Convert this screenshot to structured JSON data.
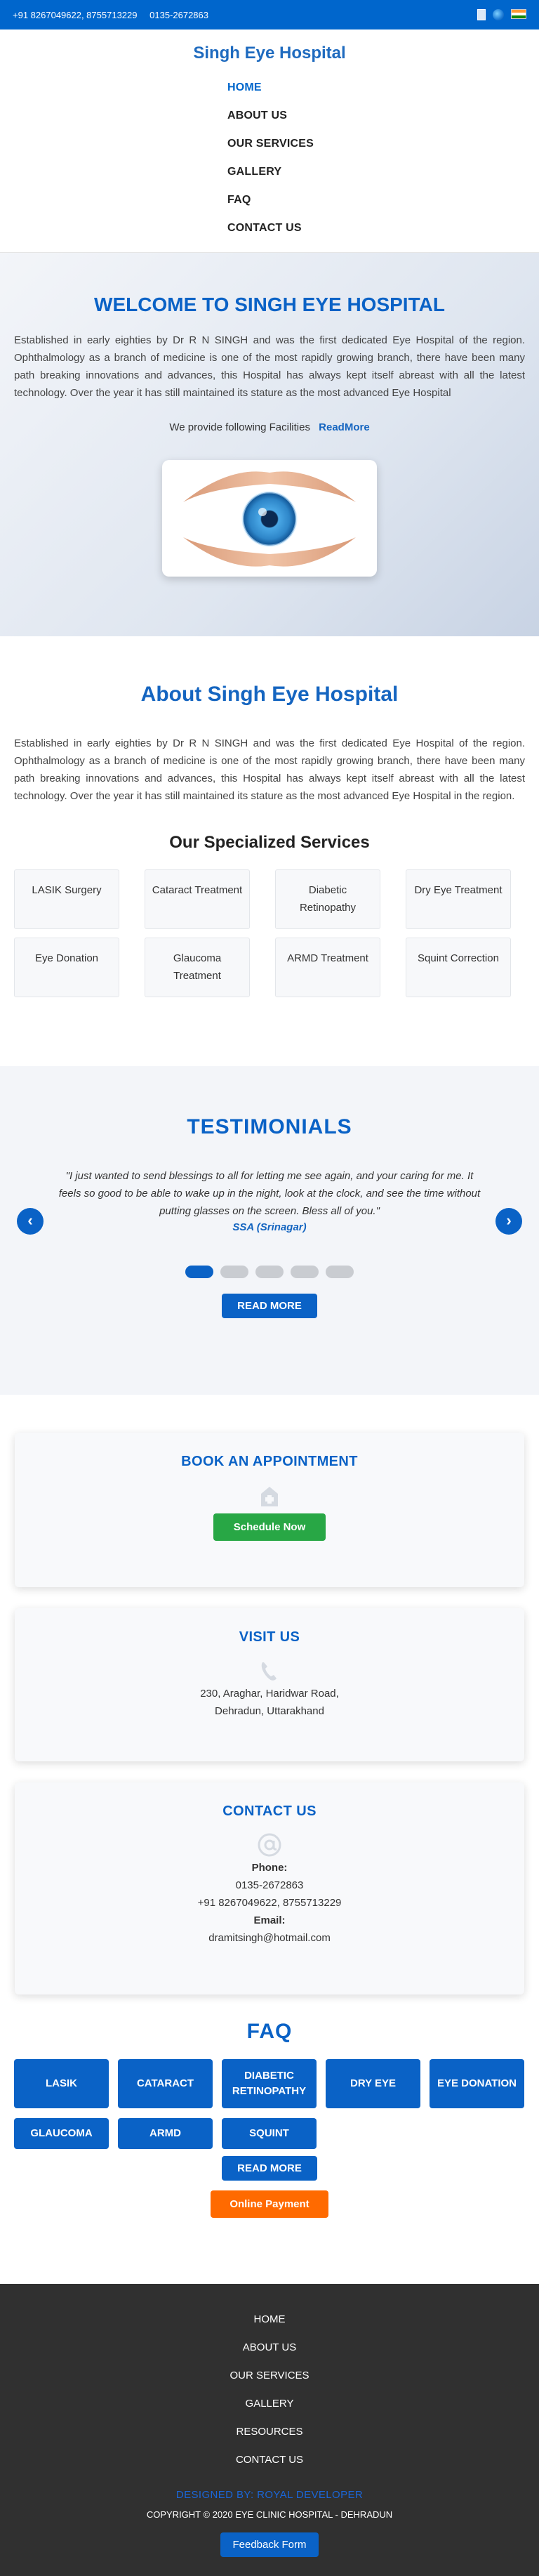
{
  "topbar": {
    "phones": "+91 8267049622, 8755713229",
    "landline": "0135-2672863",
    "icons": [
      "document-icon",
      "globe-icon",
      "india-flag-icon"
    ]
  },
  "header": {
    "brand": "Singh Eye Hospital",
    "nav": [
      "HOME",
      "ABOUT US",
      "OUR SERVICES",
      "GALLERY",
      "FAQ",
      "CONTACT US"
    ]
  },
  "welcome": {
    "title": "WELCOME TO SINGH EYE HOSPITAL",
    "body": "Established in early eighties by Dr R N SINGH and was the first dedicated Eye Hospital of the region. Ophthalmology as a branch of medicine is one of the most rapidly growing branch, there have been many path breaking innovations and advances, this Hospital has always kept itself abreast with all the latest technology. Over the year it has still maintained its stature as the most advanced Eye Hospital",
    "facilities_text": "We provide following Facilities",
    "read_more": "ReadMore"
  },
  "about": {
    "title": "About Singh Eye Hospital",
    "body": "Established in early eighties by Dr R N SINGH and was the first dedicated Eye Hospital of the region. Ophthalmology as a branch of medicine is one of the most rapidly growing branch, there have been many path breaking innovations and advances, this Hospital has always kept itself abreast with all the latest technology. Over the year it has still maintained its stature as the most advanced Eye Hospital in the region.",
    "services_title": "Our Specialized Services",
    "services": [
      "LASIK Surgery",
      "Cataract Treatment",
      "Diabetic Retinopathy",
      "Dry Eye Treatment",
      "Eye Donation",
      "Glaucoma Treatment",
      "ARMD Treatment",
      "Squint Correction"
    ]
  },
  "testimonials": {
    "title": "TESTIMONIALS",
    "quote": "\"I just wanted to send blessings to all for letting me see again, and your caring for me. It feels so good to be able to wake up in the night, look at the clock, and see the time without putting glasses on the screen. Bless all of you.\"",
    "author": "SSA (Srinagar)",
    "prev": "‹",
    "next": "›",
    "read_more": "READ MORE"
  },
  "appointment": {
    "title": "BOOK AN APPOINTMENT",
    "button": "Schedule Now"
  },
  "visit": {
    "title": "VISIT US",
    "address_line1": "230, Araghar, Haridwar Road,",
    "address_line2": "Dehradun, Uttarakhand"
  },
  "contact": {
    "title": "CONTACT US",
    "phone_label": "Phone:",
    "phone1": "0135-2672863",
    "phone2": "+91 8267049622, 8755713229",
    "email_label": "Email:",
    "email": "dramitsingh@hotmail.com"
  },
  "faq": {
    "title": "FAQ",
    "items": [
      "LASIK",
      "CATARACT",
      "DIABETIC RETINOPATHY",
      "DRY EYE",
      "EYE DONATION",
      "GLAUCOMA",
      "ARMD",
      "SQUINT"
    ],
    "read_more": "READ MORE",
    "online_payment": "Online Payment"
  },
  "footer": {
    "links": [
      "HOME",
      "ABOUT US",
      "OUR SERVICES",
      "GALLERY",
      "RESOURCES",
      "CONTACT US"
    ],
    "credit": "DESIGNED BY: ROYAL DEVELOPER",
    "copyright": "COPYRIGHT © 2020 EYE CLINIC HOSPITAL - DEHRADUN",
    "feedback": "Feedback Form"
  },
  "colors": {
    "primary": "#0a62c6",
    "topbar": "#0066cc",
    "green": "#28a745",
    "orange": "#ff6a00",
    "footer": "#303030"
  }
}
